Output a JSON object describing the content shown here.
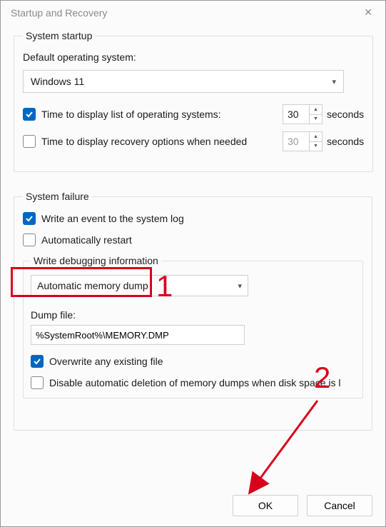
{
  "window": {
    "title": "Startup and Recovery"
  },
  "startup": {
    "legend": "System startup",
    "default_os_label": "Default operating system:",
    "default_os_value": "Windows 11",
    "display_os_list_label": "Time to display list of operating systems:",
    "display_os_list_checked": true,
    "display_os_list_seconds": "30",
    "display_recovery_label": "Time to display recovery options when needed",
    "display_recovery_checked": false,
    "display_recovery_seconds": "30",
    "seconds_label": "seconds"
  },
  "failure": {
    "legend": "System failure",
    "write_event_label": "Write an event to the system log",
    "write_event_checked": true,
    "auto_restart_label": "Automatically restart",
    "auto_restart_checked": false,
    "debug_legend": "Write debugging information",
    "debug_mode_value": "Automatic memory dump",
    "dump_file_label": "Dump file:",
    "dump_file_value": "%SystemRoot%\\MEMORY.DMP",
    "overwrite_label": "Overwrite any existing file",
    "overwrite_checked": true,
    "disable_auto_delete_label": "Disable automatic deletion of memory dumps when disk space is l",
    "disable_auto_delete_checked": false
  },
  "buttons": {
    "ok": "OK",
    "cancel": "Cancel"
  },
  "annotations": {
    "one": "1",
    "two": "2"
  }
}
